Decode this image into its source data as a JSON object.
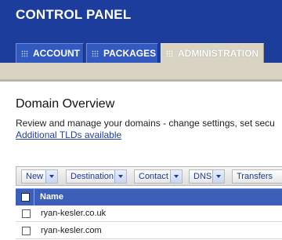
{
  "header": {
    "title": "CONTROL PANEL"
  },
  "tabs": [
    {
      "label": "ACCOUNT",
      "active": false
    },
    {
      "label": "PACKAGES",
      "active": false
    },
    {
      "label": "ADMINISTRATION",
      "active": true
    }
  ],
  "main": {
    "title": "Domain Overview",
    "description": "Review and manage your domains - change settings, set secu",
    "link": "Additional TLDs available"
  },
  "toolbar": {
    "buttons": [
      {
        "label": "New"
      },
      {
        "label": "Destination"
      },
      {
        "label": "Contact"
      },
      {
        "label": "DNS"
      },
      {
        "label": "Transfers"
      }
    ]
  },
  "grid": {
    "columns": [
      "Name"
    ],
    "rows": [
      {
        "name": "ryan-kesler.co.uk"
      },
      {
        "name": "ryan-kesler.com"
      }
    ]
  },
  "colors": {
    "header_blue": "#1d3d9c",
    "tab_blue": "#3159c0",
    "active_tab_beige": "#d9d3c3",
    "grid_header_blue": "#3c5fb9",
    "link_blue": "#1f3ea8"
  }
}
